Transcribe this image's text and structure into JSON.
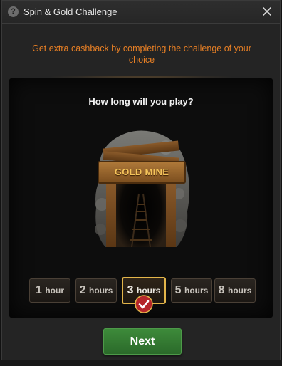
{
  "dialog": {
    "title": "Spin & Gold Challenge",
    "help_icon": "question-circle-icon",
    "close_icon": "close-icon"
  },
  "subtitle": "Get extra cashback by completing the challenge of your choice",
  "question": "How long will you play?",
  "challenge": {
    "name": "GOLD MINE"
  },
  "hour_options": [
    {
      "num": "1",
      "unit": "hour",
      "selected": false
    },
    {
      "num": "2",
      "unit": "hours",
      "selected": false
    },
    {
      "num": "3",
      "unit": "hours",
      "selected": true
    },
    {
      "num": "5",
      "unit": "hours",
      "selected": false
    },
    {
      "num": "8",
      "unit": "hours",
      "selected": false
    }
  ],
  "next_label": "Next",
  "colors": {
    "accent_orange": "#e77f24",
    "selected_border": "#e3b54a",
    "next_green": "#3d8a3a"
  }
}
